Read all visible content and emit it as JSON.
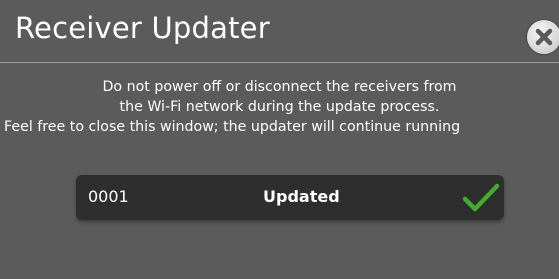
{
  "window": {
    "title": "Receiver Updater",
    "close_icon": "close-icon"
  },
  "message": {
    "line1": "Do not power off or disconnect the receivers from",
    "line2": "the Wi-Fi network during the update process.",
    "line3": "Feel free to close this window; the updater will continue running"
  },
  "receivers": [
    {
      "id": "0001",
      "status": "Updated",
      "status_icon": "checkmark-icon",
      "status_color": "#3fae2a"
    }
  ],
  "colors": {
    "background": "#5b5b5b",
    "row_background": "#2e2e2e",
    "text": "#ffffff",
    "check": "#3fae2a"
  }
}
